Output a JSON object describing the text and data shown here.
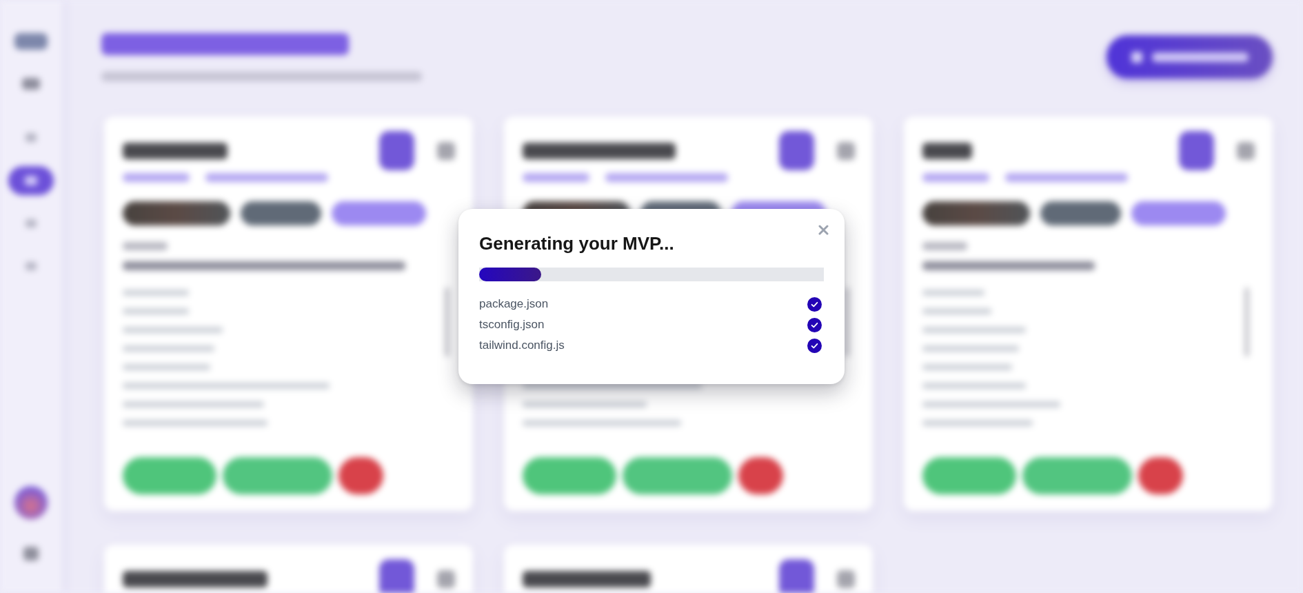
{
  "modal": {
    "title": "Generating your MVP...",
    "progress": {
      "level": 0.18
    },
    "files": [
      {
        "name": "package.json",
        "done": true
      },
      {
        "name": "tsconfig.json",
        "done": true
      },
      {
        "name": "tailwind.config.js",
        "done": true
      }
    ]
  }
}
